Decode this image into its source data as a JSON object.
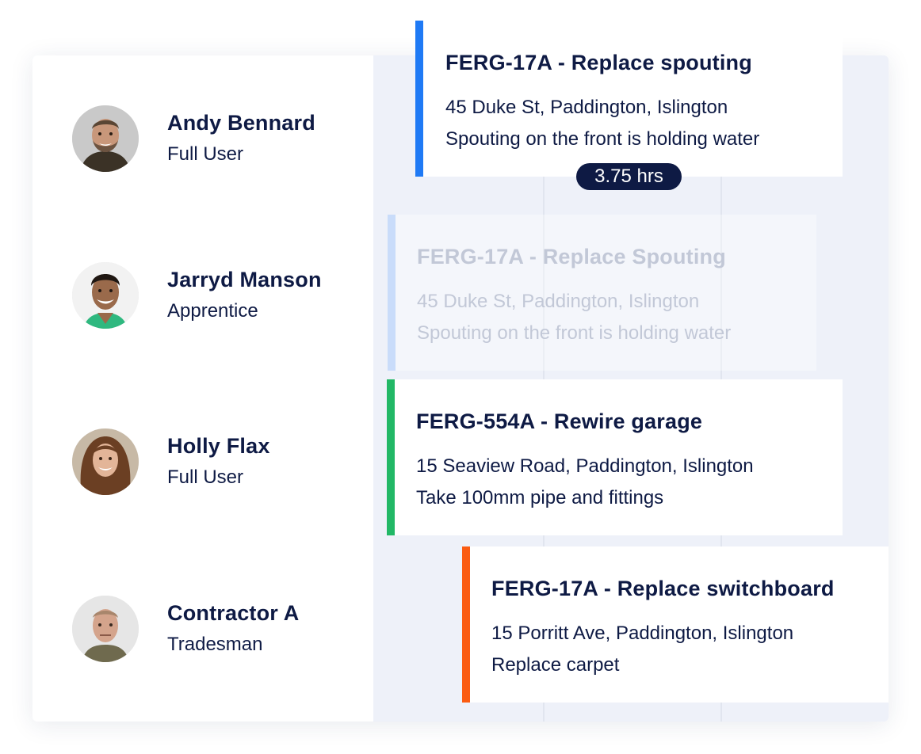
{
  "people": [
    {
      "name": "Andy Bennard",
      "role": "Full User",
      "avatar_icon": "avatar-man-beard"
    },
    {
      "name": "Jarryd Manson",
      "role": "Apprentice",
      "avatar_icon": "avatar-man-smile"
    },
    {
      "name": "Holly Flax",
      "role": "Full User",
      "avatar_icon": "avatar-woman"
    },
    {
      "name": "Contractor A",
      "role": "Tradesman",
      "avatar_icon": "avatar-man-older"
    }
  ],
  "jobs": [
    {
      "title": "FERG-17A - Replace spouting",
      "address": "45 Duke St, Paddington, Islington",
      "description": "Spouting on the front is holding water",
      "color": "#1f7af5",
      "duration": "3.75 hrs"
    },
    {
      "title": "FERG-17A - Replace Spouting",
      "address": "45 Duke St, Paddington, Islington",
      "description": "Spouting on the front is holding water",
      "color": "#c9dcfa"
    },
    {
      "title": "FERG-554A - Rewire garage",
      "address": "15 Seaview Road, Paddington, Islington",
      "description": "Take 100mm pipe and fittings",
      "color": "#22b866"
    },
    {
      "title": "FERG-17A - Replace switchboard",
      "address": "15 Porritt Ave, Paddington, Islington",
      "description": "Replace carpet",
      "color": "#fb5c12"
    }
  ]
}
